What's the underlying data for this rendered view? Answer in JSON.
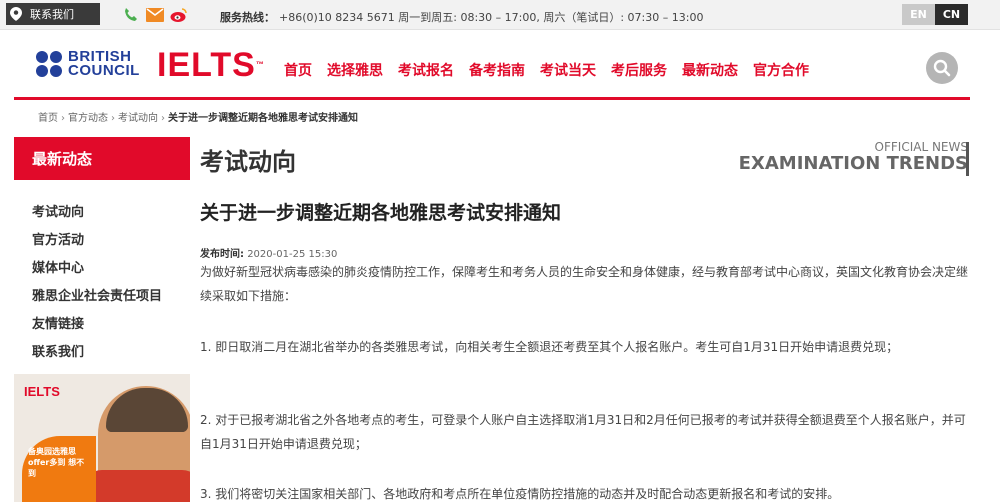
{
  "topbar": {
    "contact_label": "联系我们",
    "hotline_label": "服务热线：",
    "hotline_text": "+86(0)10 8234 5671 周一到周五: 08:30 – 17:00,   周六（笔试日）: 07:30 – 13:00",
    "lang_en": "EN",
    "lang_cn": "CN"
  },
  "header": {
    "bc_line1": "BRITISH",
    "bc_line2": "COUNCIL",
    "ielts_logo": "IELTS",
    "tm": "™",
    "nav": [
      "首页",
      "选择雅思",
      "考试报名",
      "备考指南",
      "考试当天",
      "考后服务",
      "最新动态",
      "官方合作"
    ]
  },
  "breadcrumb": {
    "items": [
      "首页",
      "官方动态",
      "考试动向"
    ],
    "current": "关于进一步调整近期各地雅思考试安排通知",
    "sep": "›"
  },
  "sidebar": {
    "heading": "最新动态",
    "items": [
      "考试动向",
      "官方活动",
      "媒体中心",
      "雅思企业社会责任项目",
      "友情链接",
      "联系我们"
    ],
    "promo_logo": "IELTS",
    "promo_text": "备奥园选雅思 offer多到 想不到"
  },
  "main": {
    "section_title": "考试动向",
    "section_en_small": "OFFICIAL NEWS",
    "section_en_big": "EXAMINATION TRENDS",
    "article_title": "关于进一步调整近期各地雅思考试安排通知",
    "pub_label": "发布时间:",
    "pub_value": "2020-01-25 15:30",
    "paragraphs": [
      "为做好新型冠状病毒感染的肺炎疫情防控工作，保障考生和考务人员的生命安全和身体健康，经与教育部考试中心商议，英国文化教育协会决定继续采取如下措施：",
      "1. 即日取消二月在湖北省举办的各类雅思考试，向相关考生全额退还考费至其个人报名账户。考生可自1月31日开始申请退费兑现；",
      "2. 对于已报考湖北省之外各地考点的考生，可登录个人账户自主选择取消1月31日和2月任何已报考的考试并获得全额退费至个人报名账户，并可自1月31日开始申请退费兑现；",
      "3. 我们将密切关注国家相关部门、各地政府和考点所在单位疫情防控措施的动态并及时配合动态更新报名和考试的安排。"
    ]
  },
  "colors": {
    "brand_red": "#e10a2a",
    "bc_blue": "#23409a"
  }
}
